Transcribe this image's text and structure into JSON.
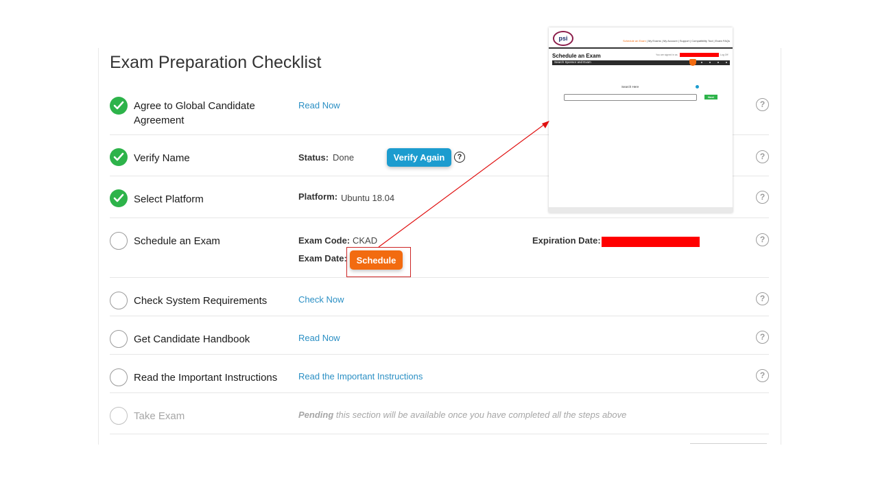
{
  "page": {
    "title": "Exam Preparation Checklist"
  },
  "steps": [
    {
      "label": "Agree to Global Candidate Agreement",
      "status": "done",
      "link": "Read Now"
    },
    {
      "label": "Verify Name",
      "status": "done",
      "status_label": "Status:",
      "status_value": "Done",
      "button": "Verify Again"
    },
    {
      "label": "Select Platform",
      "status": "done",
      "platform_label": "Platform:",
      "platform_value": "Ubuntu 18.04"
    },
    {
      "label": "Schedule an Exam",
      "status": "todo",
      "exam_code_label": "Exam Code:",
      "exam_code_value": "CKAD",
      "exam_date_label": "Exam Date:",
      "button": "Schedule",
      "expiration_label": "Expiration Date:"
    },
    {
      "label": "Check System Requirements",
      "status": "todo",
      "link": "Check Now"
    },
    {
      "label": "Get Candidate Handbook",
      "status": "todo",
      "link": "Read Now"
    },
    {
      "label": "Read the Important Instructions",
      "status": "todo",
      "link": "Read the Important Instructions"
    },
    {
      "label": "Take Exam",
      "status": "disabled",
      "pending_bold": "Pending",
      "pending_text": " this section will be available once you have completed all the steps above"
    }
  ],
  "help_glyph": "?",
  "colors": {
    "done": "#2db34a",
    "link": "#2a8fc4",
    "verify_button": "#1c9ccf",
    "schedule_button": "#f26b10",
    "redaction": "#ff0000",
    "annotation": "#cc2222"
  },
  "inset": {
    "logo": "psi",
    "nav": {
      "active": "Schedule an Exam",
      "rest": " | My Exams | My Account | Support | Compatibility Tool | Exam FAQs"
    },
    "title": "Schedule an Exam",
    "signed_in": "You are signed in as",
    "logout": "Log Off",
    "bar_text": "Search Sponsor and Exam",
    "search_label": "Search Here",
    "next_button": "Next"
  }
}
